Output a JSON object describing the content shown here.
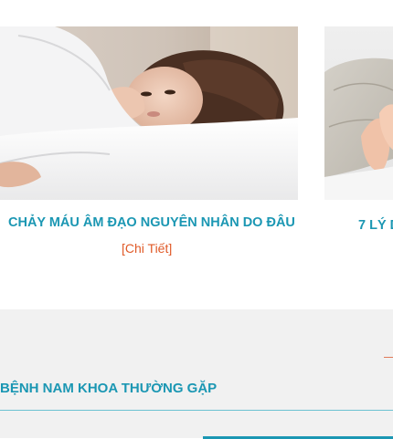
{
  "articles": [
    {
      "title": "CHẢY MÁU ÂM ĐẠO NGUYÊN NHÂN DO ĐÂU",
      "more_label": "[Chi Tiết]"
    },
    {
      "title": "7 LÝ D"
    }
  ],
  "section": {
    "heading": "BỆNH NAM KHOA THƯỜNG GẶP"
  },
  "colors": {
    "accent": "#1b97b3",
    "link": "#e05a28",
    "band": "#f1f1f1"
  }
}
